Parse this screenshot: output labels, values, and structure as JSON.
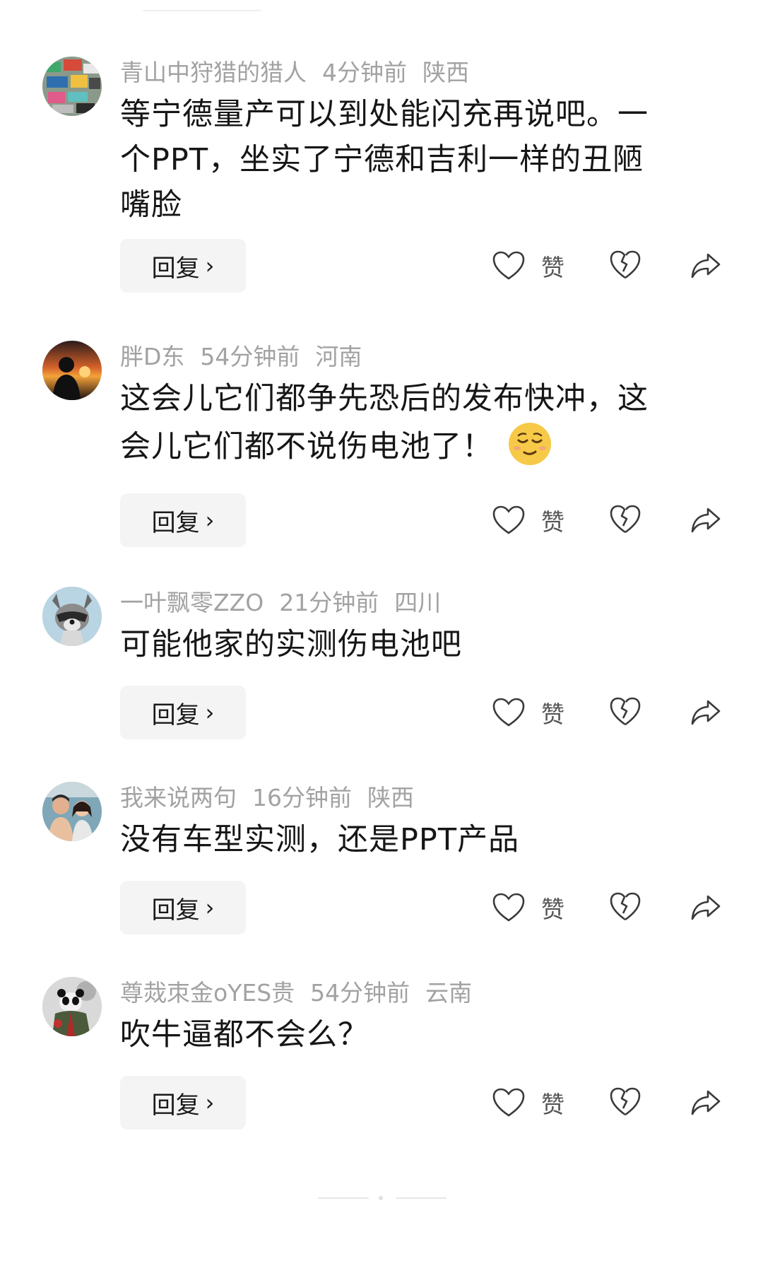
{
  "comments": [
    {
      "username": "青山中狩猎的猎人",
      "time": "4分钟前",
      "location": "陕西",
      "text_lines": [
        "等宁德量产可以到处能闪充再说吧。一",
        "个PPT，坐实了宁德和吉利一样的丑陋",
        "嘴脸"
      ],
      "reply_label": "回复",
      "like_label": "赞"
    },
    {
      "username": "胖D东",
      "time": "54分钟前",
      "location": "河南",
      "text_lines": [
        "这会儿它们都争先恐后的发布快冲，这",
        "会儿它们都不说伤电池了！"
      ],
      "emoji": "relieved-face-emoji",
      "reply_label": "回复",
      "like_label": "赞"
    },
    {
      "username": "一叶飘零ZZO",
      "time": "21分钟前",
      "location": "四川",
      "text_lines": [
        "可能他家的实测伤电池吧"
      ],
      "reply_label": "回复",
      "like_label": "赞"
    },
    {
      "username": "我来说两句",
      "time": "16分钟前",
      "location": "陕西",
      "text_lines": [
        "没有车型实测，还是PPT产品"
      ],
      "reply_label": "回复",
      "like_label": "赞"
    },
    {
      "username": "尊烖朿金oYES贵",
      "time": "54分钟前",
      "location": "云南",
      "text_lines": [
        "吹牛逼都不会么？"
      ],
      "reply_label": "回复",
      "like_label": "赞"
    }
  ],
  "icons": {
    "like": "heart-outline-icon",
    "dislike": "broken-heart-icon",
    "share": "share-arrow-icon",
    "reply_chevron": "chevron-right-icon"
  },
  "colors": {
    "meta_text": "#a2a2a2",
    "body_text": "#161616",
    "reply_bg": "#f4f4f4",
    "emoji_yellow": "#f7c948"
  }
}
